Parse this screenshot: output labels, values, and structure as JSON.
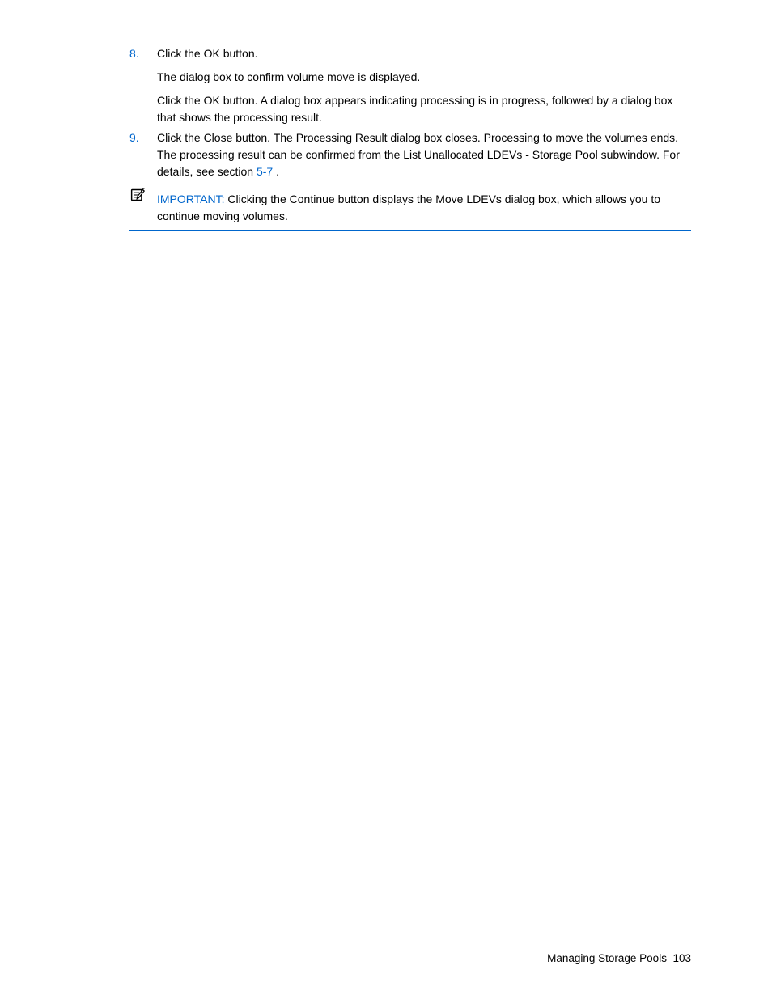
{
  "steps": [
    {
      "number": "8.",
      "paragraphs": [
        "Click the OK button.",
        "The dialog box to confirm volume move is displayed.",
        "Click the OK button. A dialog box appears indicating processing is in progress, followed by a dialog box that shows the processing result."
      ]
    },
    {
      "number": "9.",
      "text_before_link": "Click the Close button. The Processing Result dialog box closes. Processing to move the volumes ends. The processing result can be confirmed from the List Unallocated LDEVs - Storage Pool subwindow. For details, see section ",
      "link": "5-7",
      "text_after_link": " ."
    }
  ],
  "important": {
    "label": "IMPORTANT:",
    "text": "  Clicking the Continue button displays the Move LDEVs dialog box, which allows you to continue moving volumes."
  },
  "footer": {
    "title": "Managing Storage Pools",
    "page": "103"
  }
}
